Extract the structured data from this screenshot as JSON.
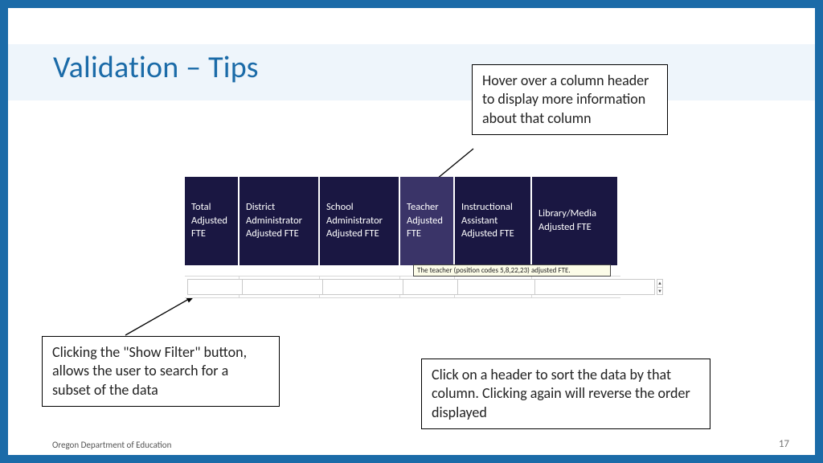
{
  "title": "Validation – Tips",
  "callouts": {
    "top": "Hover over a column header to display more information about that column",
    "left": "Clicking the \"Show Filter\" button, allows the user to search for a subset of the data",
    "right": "Click on a header to sort the data by that column. Clicking again will reverse the order displayed"
  },
  "table": {
    "headers": [
      "Total Adjusted FTE",
      "District Administrator Adjusted FTE",
      "School Administrator Adjusted FTE",
      "Teacher Adjusted FTE",
      "Instructional Assistant Adjusted FTE",
      "Library/Media Adjusted FTE"
    ],
    "tooltip": "The teacher (position codes 5,8,22,23) adjusted FTE."
  },
  "footer": {
    "org": "Oregon Department of Education",
    "page": "17"
  }
}
